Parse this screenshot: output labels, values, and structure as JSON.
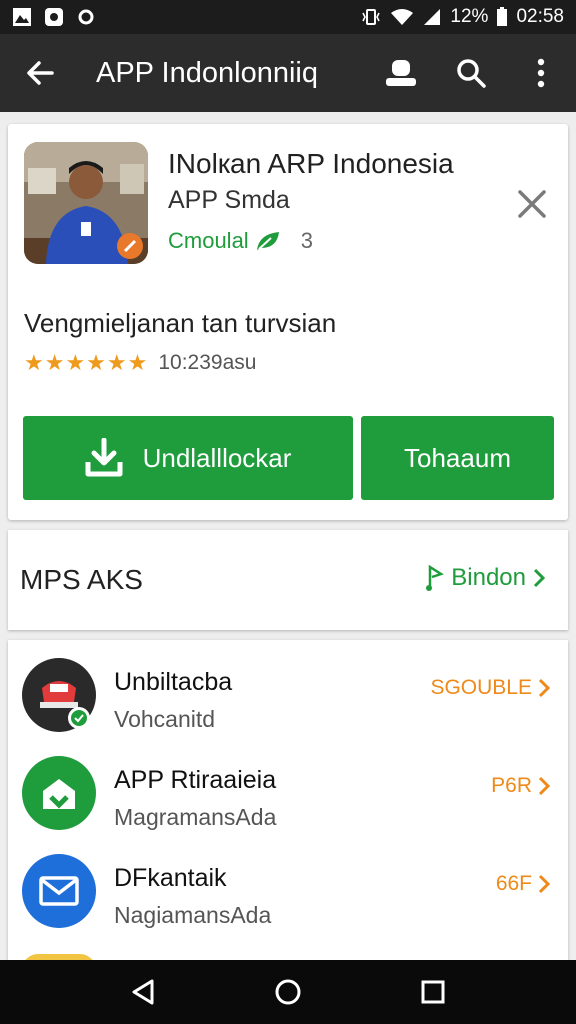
{
  "status_bar": {
    "battery": "12%",
    "time": "02:58"
  },
  "app_bar": {
    "title": "APP Indonlonniiq"
  },
  "app": {
    "name": "INolкan ARP Indonesia",
    "developer": "APP Smda",
    "category": "Cmoulal",
    "category_count": "3",
    "description": "Vengmieljanan tan turvsian",
    "stars": "★★★★★★",
    "review_count": "10:239asu",
    "install_label": "Undlalllockar",
    "open_label": "Tohaaum"
  },
  "section": {
    "title": "MPS AKS",
    "more_label": "Bindon"
  },
  "list": [
    {
      "title": "Unbiltacba",
      "subtitle": "Vohcanitd",
      "price": "SGOUBLE"
    },
    {
      "title": "APP Rtiraaieia",
      "subtitle": "MagramansAda",
      "price": "P6R"
    },
    {
      "title": "DFkantaik",
      "subtitle": "NagiamansAda",
      "price": "66F"
    }
  ],
  "colors": {
    "accent_green": "#1f9c3c",
    "price_orange": "#ef8a1a",
    "star_orange": "#ee9a1c",
    "appbar": "#2c2c2c"
  }
}
